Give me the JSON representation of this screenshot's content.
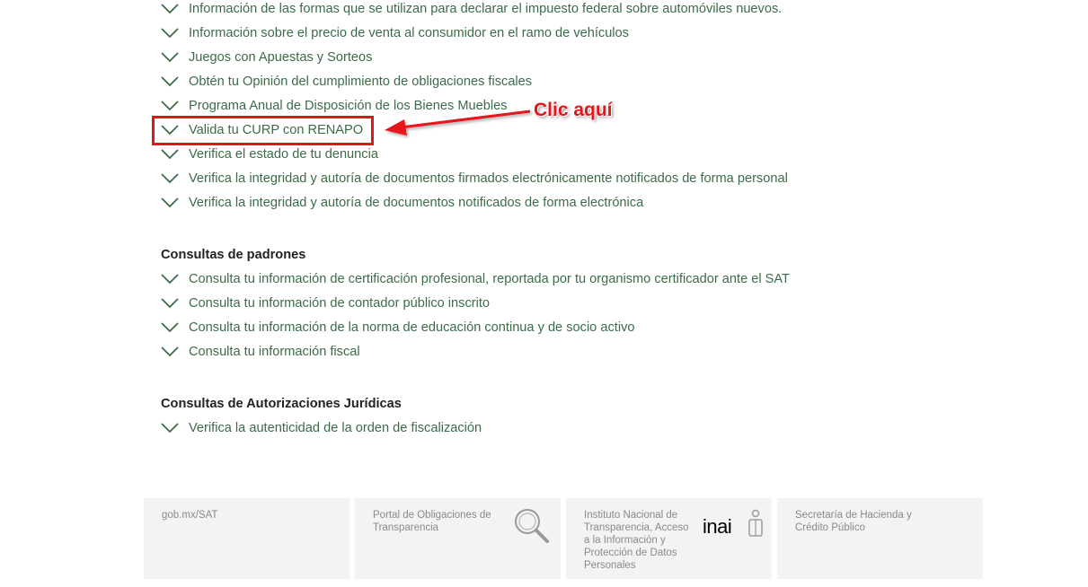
{
  "list_top": [
    "Información de las formas que se utilizan para declarar el impuesto federal sobre automóviles nuevos.",
    "Información sobre el precio de venta al consumidor en el ramo de vehículos",
    "Juegos con Apuestas y Sorteos",
    "Obtén tu Opinión del cumplimiento de obligaciones fiscales",
    "Programa Anual de Disposición de los Bienes Muebles",
    "Valida tu CURP con RENAPO",
    "Verifica el estado de tu denuncia",
    "Verifica la integridad y autoría de documentos firmados electrónicamente notificados de forma personal",
    "Verifica la integridad y autoría de documentos notificados de forma electrónica"
  ],
  "sections": [
    {
      "title": "Consultas de padrones",
      "items": [
        "Consulta tu información de certificación profesional, reportada por tu organismo certificador ante el SAT",
        "Consulta tu información de contador público inscrito",
        "Consulta tu información de la norma de educación continua y de socio activo",
        "Consulta tu información fiscal"
      ]
    },
    {
      "title": "Consultas de Autorizaciones Jurídicas",
      "items": [
        "Verifica la autenticidad de la orden de fiscalización"
      ]
    }
  ],
  "annotation": {
    "label": "Clic aquí",
    "color": "#e5141b"
  },
  "footer": [
    {
      "text": "gob.mx/SAT"
    },
    {
      "text": "Portal de Obligaciones de Transparencia",
      "icon": "magnifier-icon"
    },
    {
      "text": "Instituto Nacional de Transparencia, Acceso a la Información y Protección de Datos Personales",
      "icon": "inai-logo",
      "logo_text": "inai"
    },
    {
      "text": "Secretaría de Hacienda y Crédito Público"
    }
  ],
  "colors": {
    "link": "#3c6b48",
    "heading": "#222222",
    "footer_bg": "#f3f3f3",
    "footer_text": "#8a8a8a"
  }
}
